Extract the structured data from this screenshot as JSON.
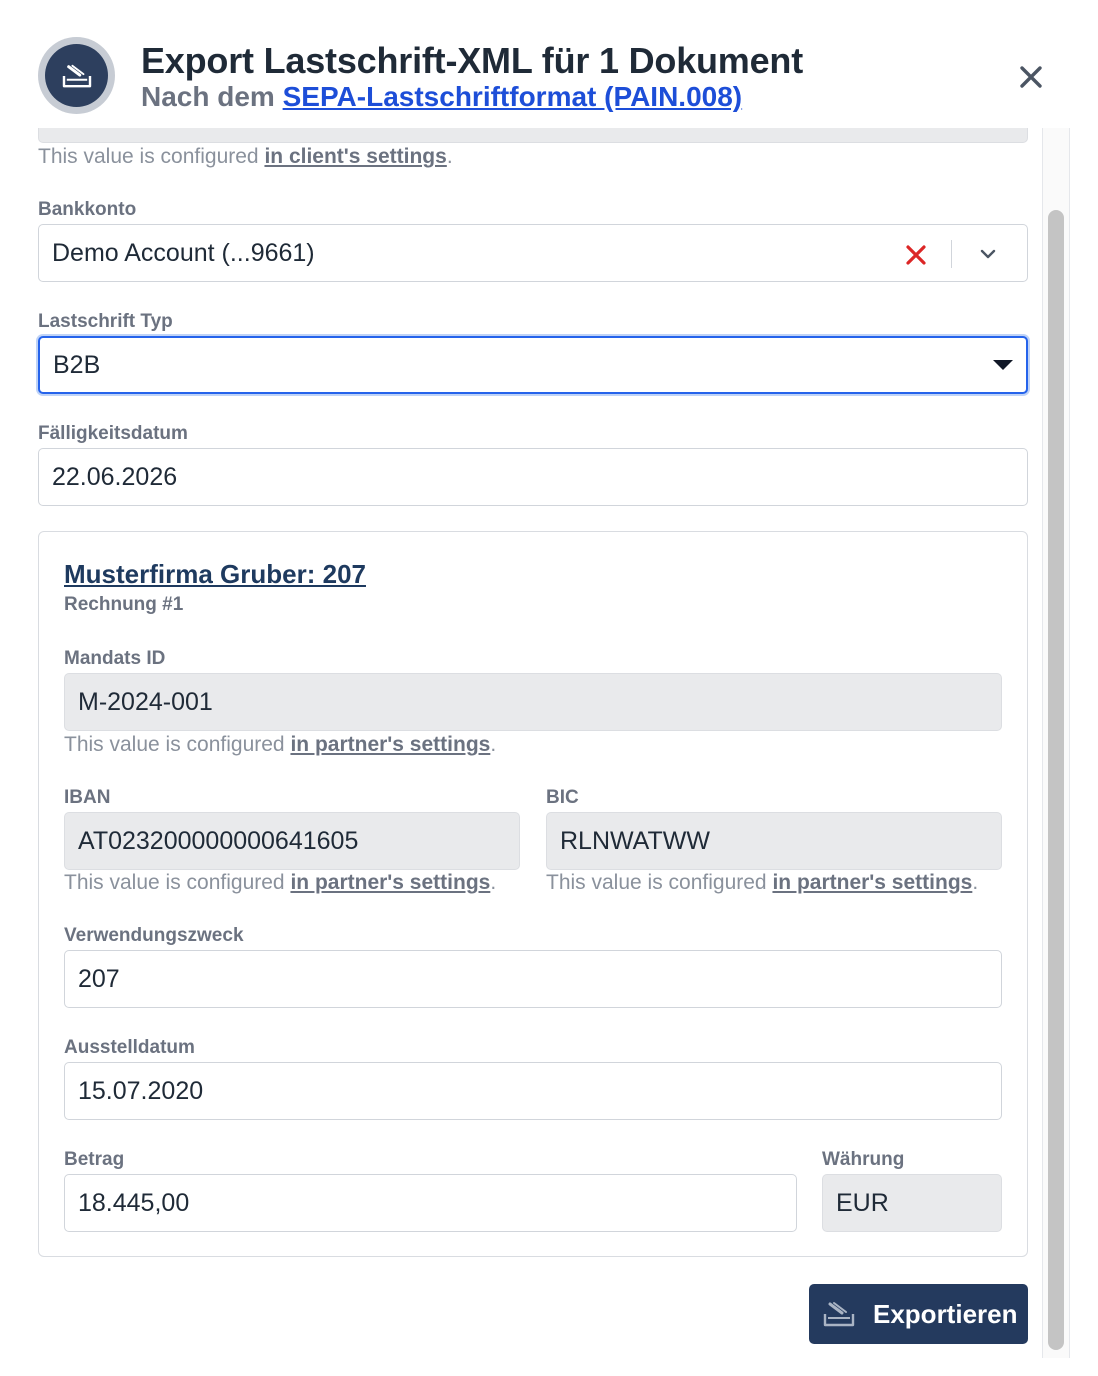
{
  "header": {
    "title": "Export Lastschrift-XML für 1 Dokument",
    "subtitle_prefix": "Nach dem ",
    "subtitle_link": "SEPA-Lastschriftformat (PAIN.008)",
    "header_icon": "direct-debit-icon",
    "close_icon": "close-icon"
  },
  "client_hint": {
    "prefix": "This value is configured ",
    "link": "in client's settings",
    "suffix": "."
  },
  "bankkonto": {
    "label": "Bankkonto",
    "value": "Demo Account (...9661)",
    "clear_icon": "clear-x-icon",
    "chevron_icon": "chevron-down-icon"
  },
  "lastschrift_typ": {
    "label": "Lastschrift Typ",
    "value": "B2B"
  },
  "faelligkeitsdatum": {
    "label": "Fälligkeitsdatum",
    "value": "22.06.2026"
  },
  "document": {
    "title": "Musterfirma Gruber: 207",
    "subtitle": "Rechnung #1",
    "mandats_id": {
      "label": "Mandats ID",
      "value": "M-2024-001"
    },
    "iban": {
      "label": "IBAN",
      "value": "AT023200000000641605"
    },
    "bic": {
      "label": "BIC",
      "value": "RLNWATWW"
    },
    "partner_hint": {
      "prefix": "This value is configured ",
      "link": "in partner's settings",
      "suffix": "."
    },
    "verwendungszweck": {
      "label": "Verwendungszweck",
      "value": "207"
    },
    "ausstelldatum": {
      "label": "Ausstelldatum",
      "value": "15.07.2020"
    },
    "betrag": {
      "label": "Betrag",
      "value": "18.445,00"
    },
    "waehrung": {
      "label": "Währung",
      "value": "EUR"
    }
  },
  "footer": {
    "export_label": "Exportieren",
    "export_icon": "direct-debit-icon"
  },
  "colors": {
    "primary": "#243a5e",
    "link": "#1d4ed8",
    "focus": "#2563eb",
    "clear": "#dc2626"
  }
}
